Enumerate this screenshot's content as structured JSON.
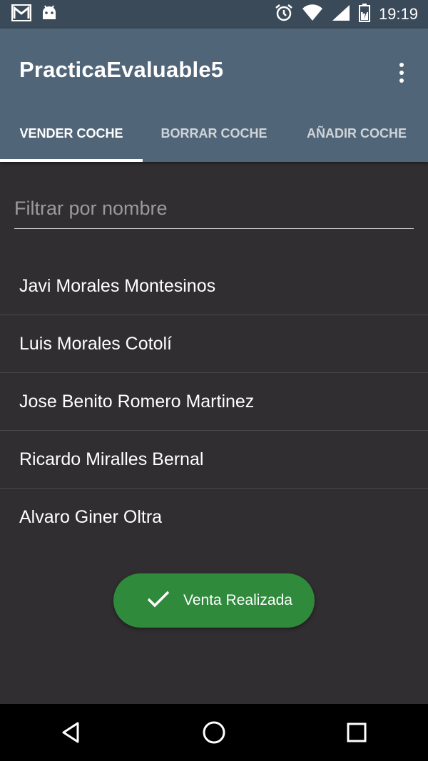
{
  "status_bar": {
    "time": "19:19",
    "icons": [
      "gmail-icon",
      "android-icon",
      "alarm-icon",
      "wifi-icon",
      "signal-icon",
      "battery-icon"
    ]
  },
  "app_bar": {
    "title": "PracticaEvaluable5",
    "menu_icon": "overflow-menu-icon"
  },
  "tabs": [
    {
      "label": "VENDER COCHE",
      "active": true
    },
    {
      "label": "BORRAR COCHE",
      "active": false
    },
    {
      "label": "AÑADIR COCHE",
      "active": false
    }
  ],
  "search": {
    "placeholder": "Filtrar por nombre",
    "value": ""
  },
  "list": [
    "Javi Morales Montesinos",
    "Luis Morales Cotolí",
    "Jose Benito Romero Martinez",
    "Ricardo Miralles Bernal",
    "Alvaro Giner Oltra"
  ],
  "toast": {
    "icon": "check-icon",
    "text": "Venta Realizada",
    "color": "#2f8a3c"
  },
  "nav_bar": {
    "buttons": [
      "back-icon",
      "home-icon",
      "recents-icon"
    ]
  },
  "colors": {
    "app_bar": "#516578",
    "status_bar": "#3b4a59",
    "background": "#302e30",
    "accent": "#ffffff"
  }
}
